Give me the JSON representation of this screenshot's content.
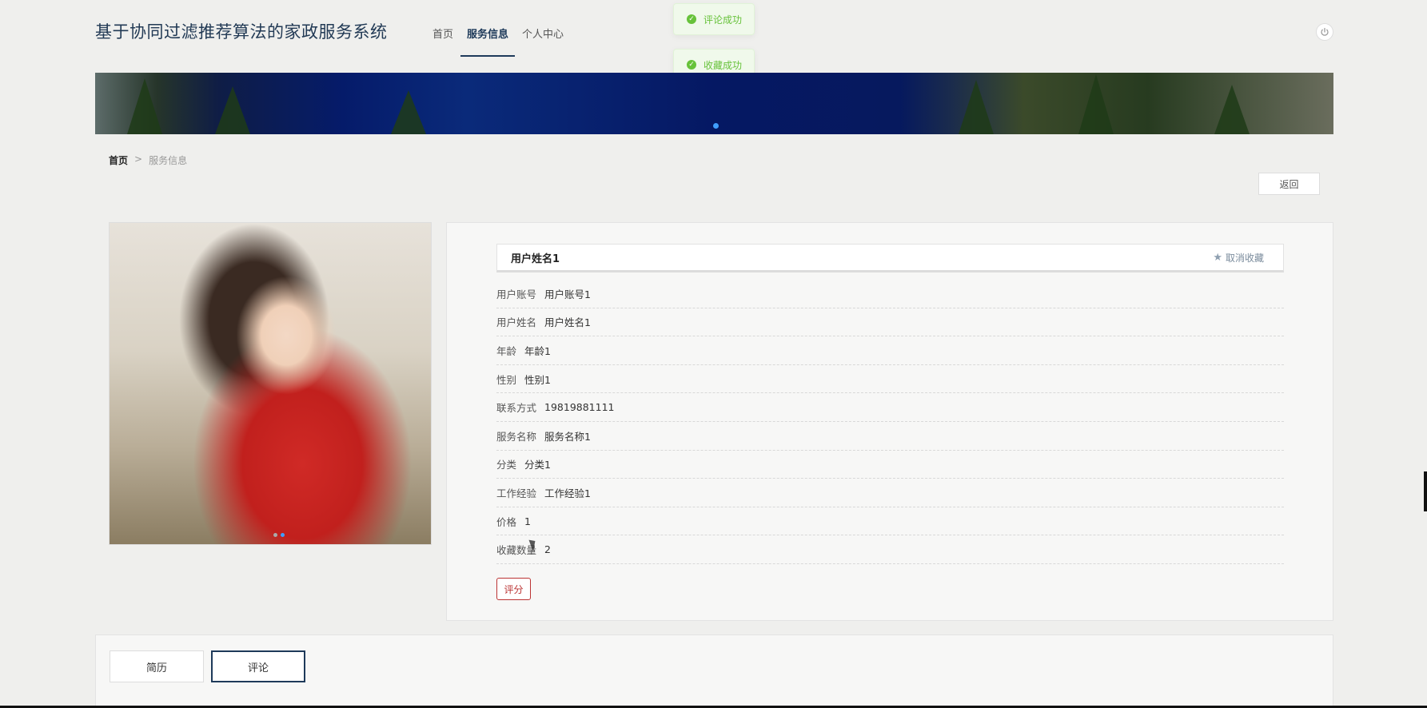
{
  "header": {
    "title": "基于协同过滤推荐算法的家政服务系统",
    "nav": [
      {
        "label": "首页"
      },
      {
        "label": "服务信息",
        "active": true
      },
      {
        "label": "个人中心"
      }
    ],
    "power_icon": "power-icon"
  },
  "toasts": [
    {
      "text": "评论成功"
    },
    {
      "text": "收藏成功"
    }
  ],
  "breadcrumb": {
    "home": "首页",
    "separator": ">",
    "current": "服务信息"
  },
  "back_label": "返回",
  "detail": {
    "name": "用户姓名1",
    "favorite_label": "取消收藏",
    "fields": [
      {
        "label": "用户账号",
        "value": "用户账号1"
      },
      {
        "label": "用户姓名",
        "value": "用户姓名1"
      },
      {
        "label": "年龄",
        "value": "年龄1"
      },
      {
        "label": "性别",
        "value": "性别1"
      },
      {
        "label": "联系方式",
        "value": "19819881111"
      },
      {
        "label": "服务名称",
        "value": "服务名称1"
      },
      {
        "label": "分类",
        "value": "分类1"
      },
      {
        "label": "工作经验",
        "value": "工作经验1"
      },
      {
        "label": "价格",
        "value": "1"
      },
      {
        "label": "收藏数量",
        "value": "2"
      }
    ],
    "rate_label": "评分"
  },
  "tabs": [
    {
      "label": "简历"
    },
    {
      "label": "评论",
      "active": true
    }
  ],
  "colors": {
    "brand": "#1e3a5a",
    "success": "#67c23a",
    "danger": "#bb3333"
  }
}
